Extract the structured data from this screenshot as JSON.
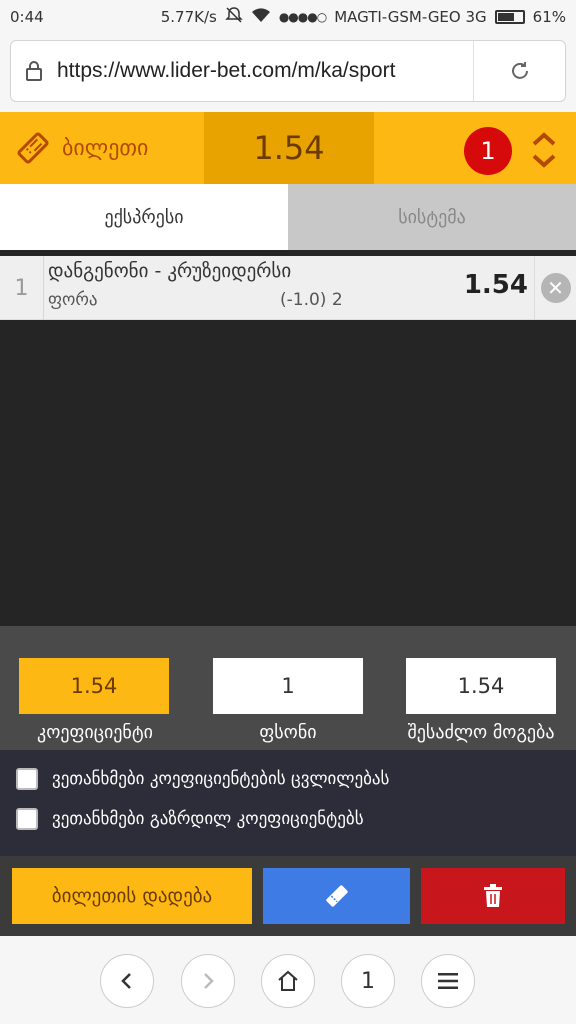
{
  "status": {
    "time": "0:44",
    "speed": "5.77K/s",
    "carrier": "MAGTI-GSM-GEO 3G",
    "battery": "61%",
    "battery_level": 0.61
  },
  "browser": {
    "url": "https://www.lider-bet.com/m/ka/sport"
  },
  "betslip": {
    "title": "ბილეთი",
    "total_odds": "1.54",
    "count": "1"
  },
  "tabs": [
    {
      "label": "ექსპრესი",
      "active": true
    },
    {
      "label": "სისტემა",
      "active": false
    }
  ],
  "bets": [
    {
      "index": "1",
      "event": "დანგენონი - კრუზეიდერსი",
      "market": "ფორა",
      "selection": "(-1.0) 2",
      "odds": "1.54"
    }
  ],
  "summary": {
    "coefficient_value": "1.54",
    "coefficient_label": "კოეფიციენტი",
    "stake_value": "1",
    "stake_label": "ფსონი",
    "win_value": "1.54",
    "win_label": "შესაძლო მოგება"
  },
  "agreements": [
    "ვეთანხმები კოეფიციენტების ცვლილებას",
    "ვეთანხმები გაზრდილ კოეფიციენტებს"
  ],
  "actions": {
    "place_label": "ბილეთის დადება",
    "ticket_icon": "ticket-icon",
    "trash_icon": "trash-icon"
  },
  "nav": {
    "tab_count": "1"
  },
  "colors": {
    "accent": "#fdb813",
    "blue": "#3f7be4",
    "red": "#c8161d"
  }
}
